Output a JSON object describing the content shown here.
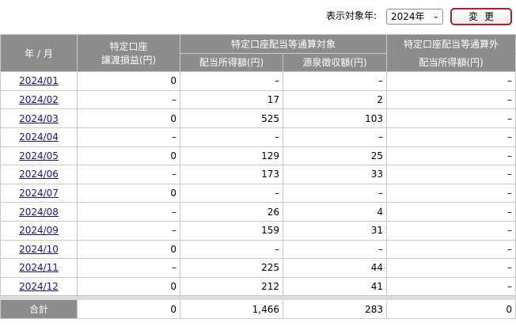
{
  "controls": {
    "year_label": "表示対象年:",
    "year_value": "2024年",
    "change_label": "変更"
  },
  "header": {
    "month": "年 / 月",
    "col1_line1": "特定口座",
    "col1_line2": "譲渡損益(円)",
    "group_target": "特定口座配当等通算対象",
    "dividend_income": "配当所得額(円)",
    "withholding_tax": "源泉徴収額(円)",
    "group_outside": "特定口座配当等通算外",
    "outside_dividend": "配当所得額(円)"
  },
  "rows": [
    {
      "month": "2024/01",
      "gain": "0",
      "dividend": "–",
      "tax": "–",
      "outside": "–"
    },
    {
      "month": "2024/02",
      "gain": "–",
      "dividend": "17",
      "tax": "2",
      "outside": "–"
    },
    {
      "month": "2024/03",
      "gain": "0",
      "dividend": "525",
      "tax": "103",
      "outside": "–"
    },
    {
      "month": "2024/04",
      "gain": "–",
      "dividend": "–",
      "tax": "–",
      "outside": "–"
    },
    {
      "month": "2024/05",
      "gain": "0",
      "dividend": "129",
      "tax": "25",
      "outside": "–"
    },
    {
      "month": "2024/06",
      "gain": "–",
      "dividend": "173",
      "tax": "33",
      "outside": "–"
    },
    {
      "month": "2024/07",
      "gain": "0",
      "dividend": "–",
      "tax": "–",
      "outside": "–"
    },
    {
      "month": "2024/08",
      "gain": "–",
      "dividend": "26",
      "tax": "4",
      "outside": "–"
    },
    {
      "month": "2024/09",
      "gain": "–",
      "dividend": "159",
      "tax": "31",
      "outside": "–"
    },
    {
      "month": "2024/10",
      "gain": "0",
      "dividend": "–",
      "tax": "–",
      "outside": "–"
    },
    {
      "month": "2024/11",
      "gain": "–",
      "dividend": "225",
      "tax": "44",
      "outside": "–"
    },
    {
      "month": "2024/12",
      "gain": "0",
      "dividend": "212",
      "tax": "41",
      "outside": "–"
    }
  ],
  "total": {
    "label": "合計",
    "gain": "0",
    "dividend": "1,466",
    "tax": "283",
    "outside": "0"
  }
}
